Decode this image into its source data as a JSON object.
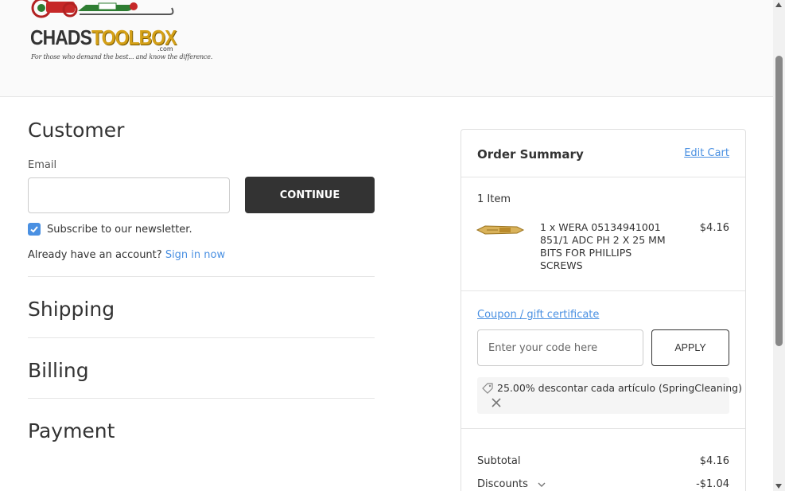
{
  "logo": {
    "brand_dark": "CHADS",
    "brand_gold": "TOOLBOX",
    "com": ".com",
    "tagline": "For those who demand the best... and know the difference."
  },
  "customer": {
    "title": "Customer",
    "email_label": "Email",
    "email_value": "",
    "continue_label": "CONTINUE",
    "subscribe_label": "Subscribe to our newsletter.",
    "subscribe_checked": true,
    "account_text": "Already have an account?",
    "sign_in_label": "Sign in now"
  },
  "steps": {
    "shipping": "Shipping",
    "billing": "Billing",
    "payment": "Payment"
  },
  "order_summary": {
    "title": "Order Summary",
    "edit_cart": "Edit Cart",
    "item_count": "1 Item",
    "items": [
      {
        "name": "1 x WERA 05134941001 851/1 ADC PH 2 X 25 MM BITS FOR PHILLIPS SCREWS",
        "price": "$4.16"
      }
    ],
    "coupon_link": "Coupon / gift certificate",
    "coupon_placeholder": "Enter your code here",
    "apply_label": "APPLY",
    "applied_coupon": "25.00% descontar cada artículo (SpringCleaning)",
    "subtotal_label": "Subtotal",
    "subtotal_value": "$4.16",
    "discounts_label": "Discounts",
    "discounts_value": "-$1.04"
  },
  "colors": {
    "accent": "#4a90e2",
    "button_dark": "#333333",
    "brand_gold": "#d4a017"
  },
  "icons": [
    "tag-icon",
    "close-icon",
    "chevron-down-icon",
    "check-icon"
  ]
}
